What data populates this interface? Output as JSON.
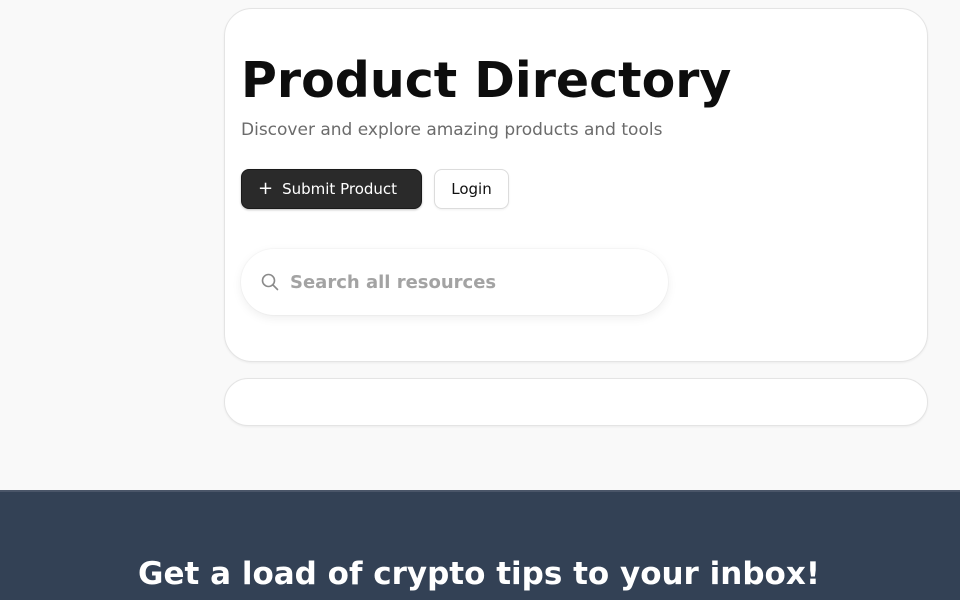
{
  "hero": {
    "title": "Product Directory",
    "subtitle": "Discover and explore amazing products and tools",
    "submit_button": {
      "icon": "plus-icon",
      "label": "Submit Product"
    },
    "login_button": {
      "label": "Login"
    },
    "search": {
      "icon": "search-icon",
      "placeholder": "Search all resources"
    }
  },
  "newsletter": {
    "title": "Get a load of crypto tips to your inbox!"
  },
  "colors": {
    "page_background": "#f9f9f9",
    "primary_button": "#2a2a2a",
    "newsletter_background": "#334155"
  }
}
